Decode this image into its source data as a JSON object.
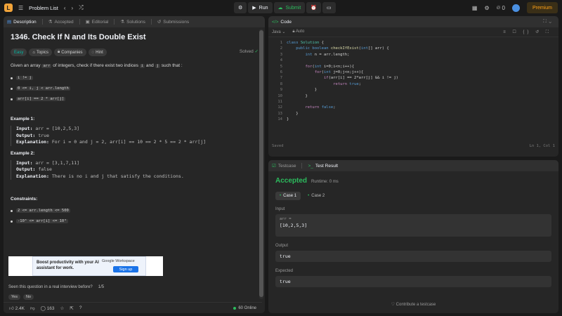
{
  "topbar": {
    "logo": "L",
    "problem_list": "Problem List",
    "run_label": "Run",
    "submit_label": "Submit",
    "fire_count": "0",
    "premium_label": "Premium"
  },
  "left_tabs": [
    "Description",
    "Accepted",
    "Editorial",
    "Solutions",
    "Submissions"
  ],
  "problem": {
    "title": "1346. Check If N and Its Double Exist",
    "status": "Solved",
    "chips": [
      "Easy",
      "Topics",
      "Companies",
      "Hint"
    ],
    "statement_pre": "Given an array",
    "statement_code1": "arr",
    "statement_mid": "of integers, check if there exist two indices",
    "statement_code2": "i",
    "statement_and": "and",
    "statement_code3": "j",
    "statement_post": "such that :",
    "conditions": [
      "i != j",
      "0 <= i, j < arr.length",
      "arr[i] == 2 * arr[j]"
    ],
    "example1_title": "Example 1:",
    "example1_input_label": "Input:",
    "example1_input": "arr = [10,2,5,3]",
    "example1_output_label": "Output:",
    "example1_output": "true",
    "example1_expl_label": "Explanation:",
    "example1_expl": "For i = 0 and j = 2, arr[i] == 10 == 2 * 5 == 2 * arr[j]",
    "example2_title": "Example 2:",
    "example2_input_label": "Input:",
    "example2_input": "arr = [3,1,7,11]",
    "example2_output_label": "Output:",
    "example2_output": "false",
    "example2_expl_label": "Explanation:",
    "example2_expl": "There is no i and j that satisfy the conditions.",
    "constraints_title": "Constraints:",
    "constraints": [
      "2 <= arr.length <= 500",
      "-10³ <= arr[i] <= 10³"
    ]
  },
  "ad": {
    "text": "Boost productivity with your AI assistant for work.",
    "brand": "Google Workspace",
    "button": "Sign up"
  },
  "feedback": {
    "question": "Seen this question in a real interview before?",
    "page": "1/5",
    "yes": "Yes",
    "no": "No"
  },
  "footer": {
    "likes": "2.4K",
    "comments": "163",
    "online": "60 Online"
  },
  "editor": {
    "tab": "Code",
    "language": "Java",
    "mode": "Auto",
    "saved": "Saved",
    "position": "Ln 1, Col 1",
    "line_numbers": [
      "1",
      "2",
      "3",
      "4",
      "5",
      "6",
      "7",
      "8",
      "9",
      "10",
      "11",
      "12",
      "13",
      "14"
    ]
  },
  "result": {
    "tab_testcase": "Testcase",
    "tab_result": "Test Result",
    "status": "Accepted",
    "runtime": "Runtime: 0 ms",
    "cases": [
      "Case 1",
      "Case 2"
    ],
    "input_label": "Input",
    "input_var": "arr =",
    "input_value": "[10,2,5,3]",
    "output_label": "Output",
    "output_value": "true",
    "expected_label": "Expected",
    "expected_value": "true",
    "contribute": "Contribute a testcase"
  },
  "colors": {
    "accent_green": "#2cbb5d",
    "premium": "#ffa116",
    "easy": "#00b8a3"
  }
}
